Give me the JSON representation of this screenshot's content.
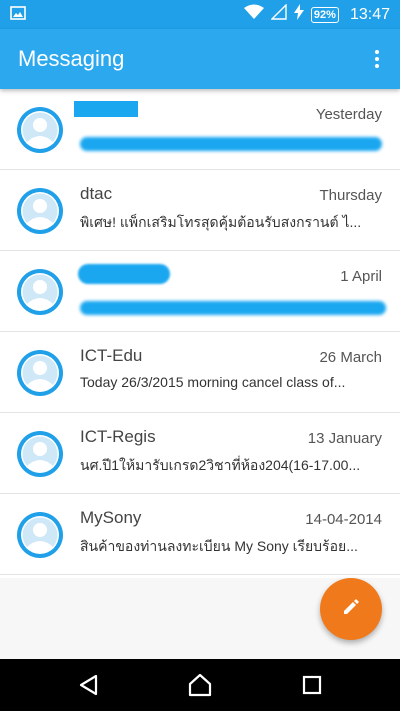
{
  "status_bar": {
    "time": "13:47",
    "battery": "92%",
    "icons": [
      "image-notification-icon",
      "wifi-icon",
      "signal-icon",
      "charging-icon",
      "battery-icon"
    ]
  },
  "app_bar": {
    "title": "Messaging",
    "menu_icon": "overflow-menu-icon"
  },
  "conversations": [
    {
      "name": "",
      "date": "Yesterday",
      "snippet": "",
      "redacted": true
    },
    {
      "name": "dtac",
      "date": "Thursday",
      "snippet": "พิเศษ! แพ็กเสริมโทรสุดคุ้มต้อนรับสงกรานต์ ไ...",
      "redacted": false
    },
    {
      "name": "",
      "date": "1 April",
      "snippet": "",
      "redacted": true
    },
    {
      "name": "ICT-Edu",
      "date": "26 March",
      "snippet": "Today 26/3/2015 morning cancel class of...",
      "redacted": false
    },
    {
      "name": "ICT-Regis",
      "date": "13 January",
      "snippet": "นศ.ปี1ให้มารับเกรด2วิชาที่ห้อง204(16-17.00...",
      "redacted": false
    },
    {
      "name": "MySony",
      "date": "14-04-2014",
      "snippet": "สินค้าของท่านลงทะเบียน My Sony เรียบร้อย...",
      "redacted": false
    }
  ],
  "fab": {
    "icon": "pencil-icon"
  },
  "nav_bar": {
    "icons": [
      "back-icon",
      "home-icon",
      "recents-icon"
    ]
  },
  "colors": {
    "status_bar": "#1FA0E8",
    "app_bar": "#2BA8EE",
    "fab": "#F07A1B",
    "avatar": "#1FA0E8",
    "nav_bar": "#000000"
  }
}
